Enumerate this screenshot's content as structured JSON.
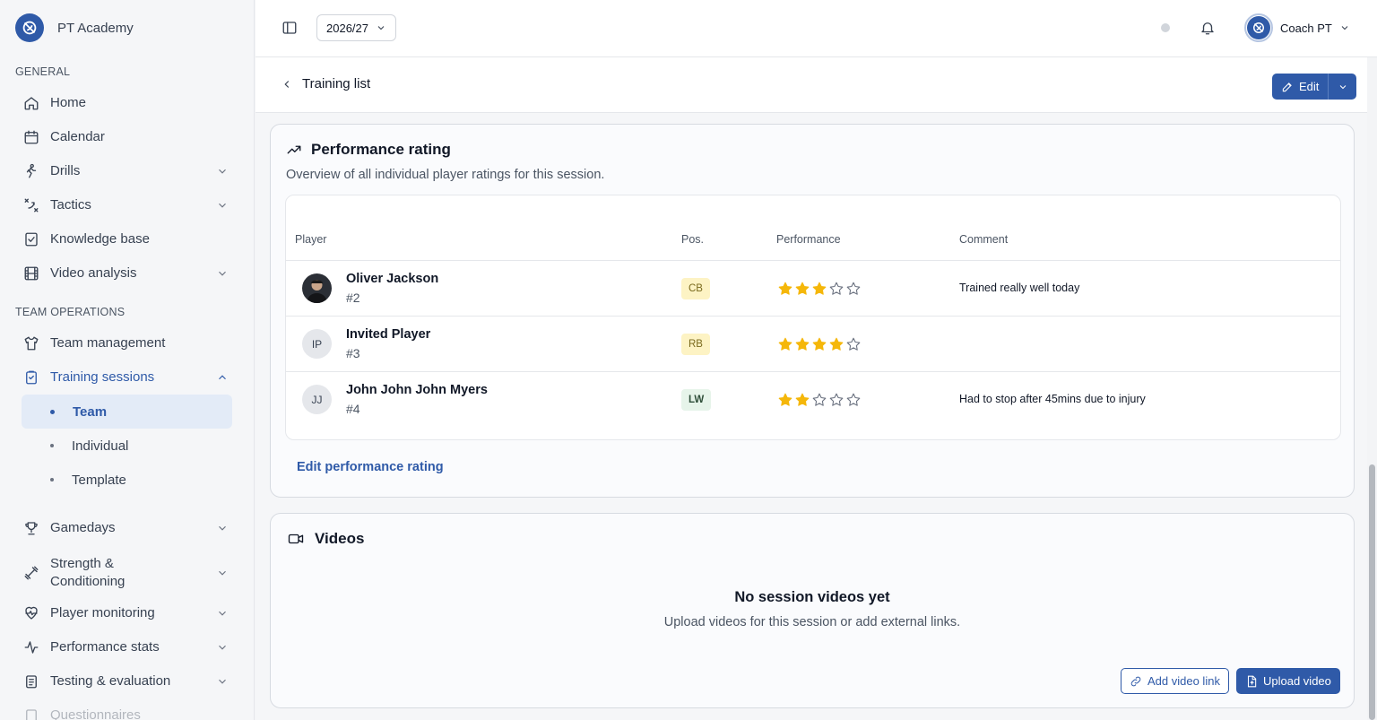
{
  "brand": {
    "name": "PT Academy"
  },
  "sidebar": {
    "general_label": "GENERAL",
    "team_ops_label": "TEAM OPERATIONS",
    "items": {
      "home": "Home",
      "calendar": "Calendar",
      "drills": "Drills",
      "tactics": "Tactics",
      "knowledge": "Knowledge base",
      "video": "Video analysis",
      "team_management": "Team management",
      "training_sessions": "Training sessions",
      "team": "Team",
      "individual": "Individual",
      "template": "Template",
      "gamedays": "Gamedays",
      "strength_line1": "Strength &",
      "strength_line2": "Conditioning",
      "player_monitoring": "Player monitoring",
      "performance_stats": "Performance stats",
      "testing": "Testing & evaluation",
      "questionnaires": "Questionnaires"
    }
  },
  "topbar": {
    "season": "2026/27",
    "user_name": "Coach PT"
  },
  "subheader": {
    "back_label": "Training list",
    "edit_label": "Edit"
  },
  "performance": {
    "title": "Performance rating",
    "description": "Overview of all individual player ratings for this session.",
    "headers": {
      "player": "Player",
      "pos": "Pos.",
      "performance": "Performance",
      "comment": "Comment"
    },
    "rows": [
      {
        "name": "Oliver Jackson",
        "number": "#2",
        "initials": "",
        "pos": "CB",
        "pos_type": "def",
        "rating": 3,
        "comment": "Trained really well today"
      },
      {
        "name": "Invited Player",
        "number": "#3",
        "initials": "IP",
        "pos": "RB",
        "pos_type": "def",
        "rating": 4,
        "comment": ""
      },
      {
        "name": "John John John Myers",
        "number": "#4",
        "initials": "JJ",
        "pos": "LW",
        "pos_type": "att",
        "rating": 2,
        "comment": "Had to stop after 45mins due to injury"
      }
    ],
    "max_rating": 5,
    "edit_link": "Edit performance rating"
  },
  "videos": {
    "title": "Videos",
    "empty_title": "No session videos yet",
    "empty_sub": "Upload videos for this session or add external links.",
    "add_link": "Add video link",
    "upload": "Upload video"
  },
  "colors": {
    "accent": "#2f5aa8",
    "star": "#f5b70a",
    "star_empty": "#6b7280"
  }
}
